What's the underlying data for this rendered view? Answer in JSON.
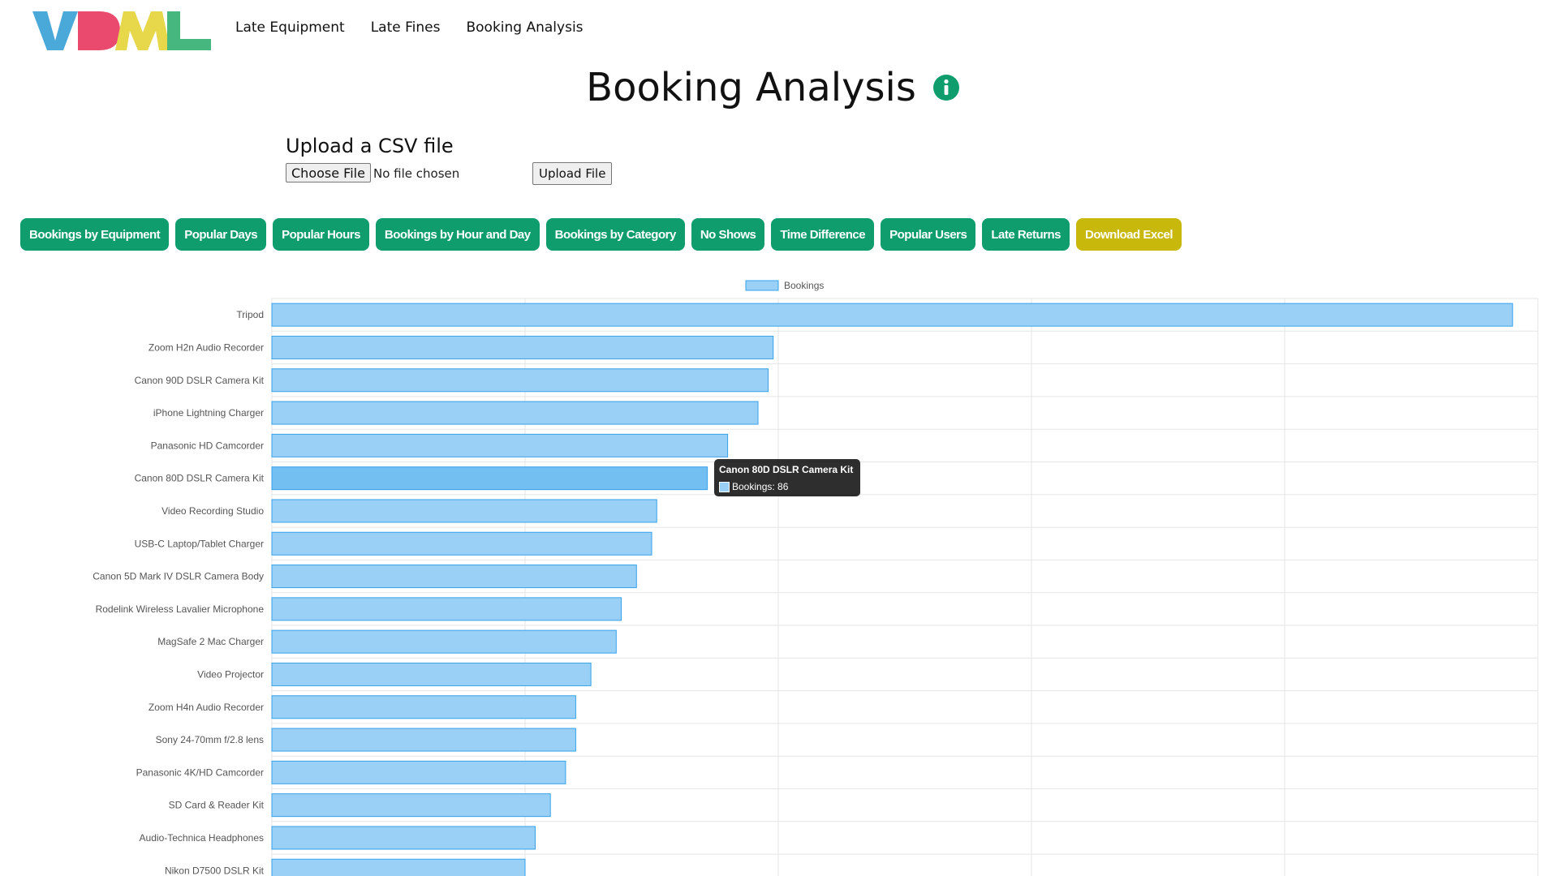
{
  "logo": {
    "text": "VDML"
  },
  "nav": {
    "items": [
      {
        "label": "Late Equipment"
      },
      {
        "label": "Late Fines"
      },
      {
        "label": "Booking Analysis"
      }
    ]
  },
  "page": {
    "title": "Booking Analysis"
  },
  "upload": {
    "heading": "Upload a CSV file",
    "choose_label": "Choose File",
    "file_status": "No file chosen",
    "submit_label": "Upload File"
  },
  "tabs": [
    {
      "label": "Bookings by Equipment"
    },
    {
      "label": "Popular Days"
    },
    {
      "label": "Popular Hours"
    },
    {
      "label": "Bookings by Hour and Day"
    },
    {
      "label": "Bookings by Category"
    },
    {
      "label": "No Shows"
    },
    {
      "label": "Time Difference"
    },
    {
      "label": "Popular Users"
    },
    {
      "label": "Late Returns"
    },
    {
      "label": "Download Excel"
    }
  ],
  "colors": {
    "accent": "#0f9d6e",
    "download": "#c9b80c",
    "bar_fill": "#9ad0f5",
    "bar_stroke": "#36a2eb",
    "info_icon": "#0f9d6e"
  },
  "chart_data": {
    "type": "bar",
    "orientation": "horizontal",
    "categories": [
      "Tripod",
      "Zoom H2n Audio Recorder",
      "Canon 90D DSLR Camera Kit",
      "iPhone Lightning Charger",
      "Panasonic HD Camcorder",
      "Canon 80D DSLR Camera Kit",
      "Video Recording Studio",
      "USB-C Laptop/Tablet Charger",
      "Canon 5D Mark IV DSLR Camera Body",
      "Rodelink Wireless Lavalier Microphone",
      "MagSafe 2 Mac Charger",
      "Video Projector",
      "Zoom H4n Audio Recorder",
      "Sony 24-70mm f/2.8 lens",
      "Panasonic 4K/HD Camcorder",
      "SD Card & Reader Kit",
      "Audio-Technica Headphones",
      "Nikon D7500 DSLR Kit"
    ],
    "series": [
      {
        "name": "Bookings",
        "values": [
          245,
          99,
          98,
          96,
          90,
          86,
          76,
          75,
          72,
          69,
          68,
          63,
          60,
          60,
          58,
          55,
          52,
          50
        ]
      }
    ],
    "xlim": [
      0,
      250
    ],
    "x_gridlines": [
      0,
      50,
      100,
      150,
      200,
      250
    ],
    "grid": true,
    "legend": {
      "position": "top-center",
      "label": "Bookings"
    },
    "tooltip": {
      "title": "Canon 80D DSLR Camera Kit",
      "label": "Bookings: 86"
    }
  }
}
